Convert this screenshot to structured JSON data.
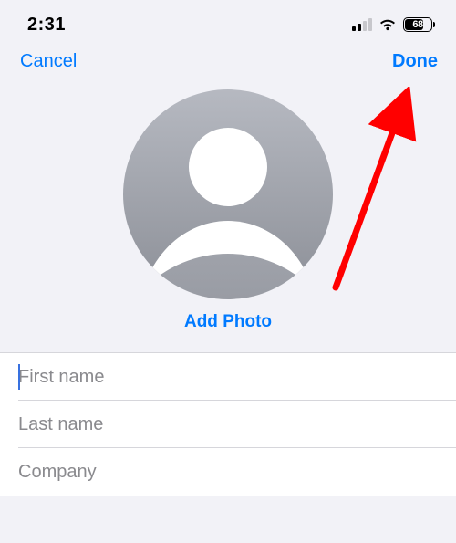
{
  "status": {
    "time": "2:31",
    "battery_pct": "68"
  },
  "nav": {
    "cancel": "Cancel",
    "done": "Done"
  },
  "avatar": {
    "add_photo": "Add Photo"
  },
  "fields": {
    "first_name": {
      "value": "",
      "placeholder": "First name"
    },
    "last_name": {
      "value": "",
      "placeholder": "Last name"
    },
    "company": {
      "value": "",
      "placeholder": "Company"
    }
  }
}
